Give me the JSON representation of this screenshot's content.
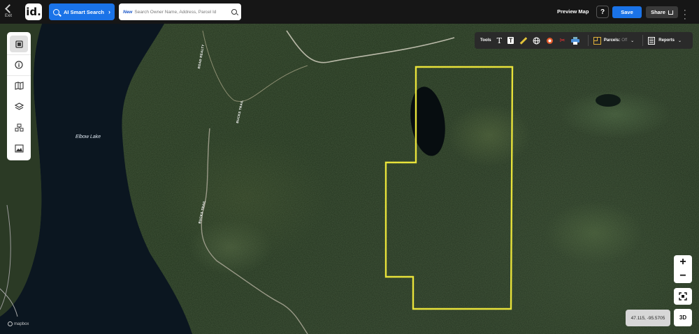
{
  "header": {
    "exit_label": "Exit",
    "logo_text": "id.",
    "ai_search_label": "AI Smart Search",
    "search_new_tag": "New",
    "search_placeholder": "Search Owner Name, Address, Parcel Id",
    "preview_map_label": "Preview Map",
    "help_label": "?",
    "save_label": "Save",
    "share_label": "Share",
    "more_icon": "vertical-dots-icon"
  },
  "left_toolbar": {
    "items": [
      {
        "name": "panel-toggle-icon",
        "active": true
      },
      {
        "name": "info-icon",
        "active": false
      },
      {
        "name": "map-book-icon",
        "active": false
      },
      {
        "name": "layers-icon",
        "active": false
      },
      {
        "name": "buildings-icon",
        "active": false
      },
      {
        "name": "image-icon",
        "active": false
      }
    ]
  },
  "tools_bar": {
    "tools_label": "Tools",
    "parcels_label": "Parcels:",
    "parcels_state": "Off",
    "reports_label": "Reports",
    "icons": [
      "text-icon",
      "text-box-icon",
      "ruler-icon",
      "globe-icon",
      "target-icon",
      "scissors-icon",
      "print-icon"
    ]
  },
  "map": {
    "lake_label": "Elbow Lake",
    "road_labels": [
      "ROAD REALTY",
      "BUCKS TRAIL",
      "BUCKS TRAIL"
    ],
    "coordinates": "47.115, -95.5705",
    "attribution": "mapbox",
    "boundary_color": "#e8e23a"
  },
  "controls": {
    "zoom_in": "+",
    "zoom_out": "−",
    "three_d_label": "3D"
  }
}
